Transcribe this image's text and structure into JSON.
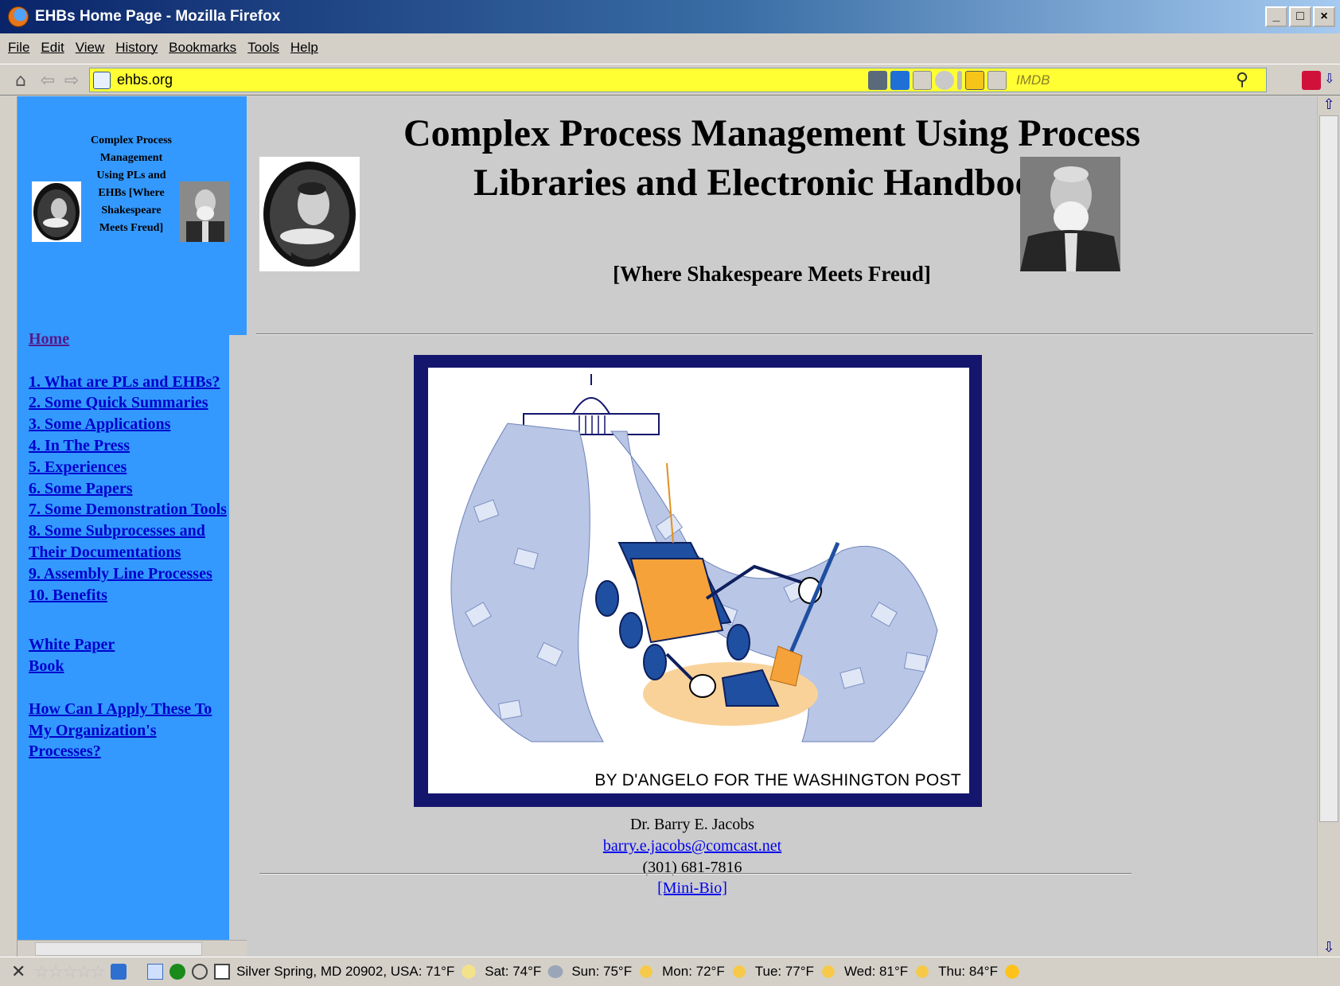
{
  "window": {
    "title": "EHBs Home Page - Mozilla Firefox"
  },
  "menu": [
    "File",
    "Edit",
    "View",
    "History",
    "Bookmarks",
    "Tools",
    "Help"
  ],
  "toolbar": {
    "url": "ehbs.org",
    "search_placeholder": "IMDB"
  },
  "sidebar": {
    "title": "Complex Process Management Using PLs and EHBs [Where Shakespeare Meets Freud]",
    "home": "Home",
    "items": [
      "1. What are PLs and EHBs?",
      "2. Some Quick Summaries",
      "3. Some Applications",
      "4. In The Press",
      "5. Experiences",
      "6. Some Papers",
      "7. Some Demonstration Tools",
      "8. Some Subprocesses and Their Documentations",
      "9. Assembly Line Processes",
      "10. Benefits"
    ],
    "extra": [
      "White Paper",
      "Book"
    ],
    "apply": "How Can I Apply These To My Organization's Processes?"
  },
  "main": {
    "title": "Complex Process Management Using Process Libraries and Electronic Handbooks",
    "subtitle": "[Where Shakespeare Meets Freud]",
    "cartoon_credit": "BY D'ANGELO FOR THE WASHINGTON POST",
    "contact": {
      "name": "Dr. Barry E. Jacobs",
      "email": "barry.e.jacobs@comcast.net",
      "phone": "(301) 681-7816",
      "bio": "[Mini-Bio]"
    }
  },
  "status": {
    "location": "Silver Spring, MD 20902, USA: 71°F",
    "forecast": [
      "Sat: 74°F",
      "Sun: 75°F",
      "Mon: 72°F",
      "Tue: 77°F",
      "Wed: 81°F",
      "Thu: 84°F"
    ]
  },
  "colors": {
    "sidebar": "#3399ff",
    "page": "#cccccc",
    "urlbar": "#ffff33",
    "frame": "#14166e",
    "link": "#0000cc"
  }
}
